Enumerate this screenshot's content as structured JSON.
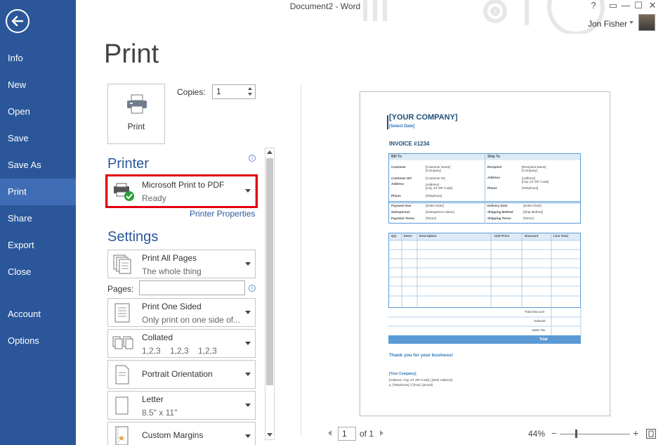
{
  "window": {
    "title": "Document2 - Word",
    "user": "Jon Fisher",
    "controls": [
      "?",
      "▭",
      "—",
      "☐",
      "✕"
    ]
  },
  "sidebar": {
    "items": [
      {
        "label": "Info"
      },
      {
        "label": "New"
      },
      {
        "label": "Open"
      },
      {
        "label": "Save"
      },
      {
        "label": "Save As"
      },
      {
        "label": "Print",
        "active": true
      },
      {
        "label": "Share"
      },
      {
        "label": "Export"
      },
      {
        "label": "Close"
      },
      {
        "label": "Account"
      },
      {
        "label": "Options"
      }
    ]
  },
  "print": {
    "heading": "Print",
    "button_label": "Print",
    "copies_label": "Copies:",
    "copies_value": "1"
  },
  "printer": {
    "heading": "Printer",
    "name": "Microsoft Print to PDF",
    "status": "Ready",
    "properties_link": "Printer Properties"
  },
  "settings": {
    "heading": "Settings",
    "pages_label": "Pages:",
    "pages_value": "",
    "options": [
      {
        "main": "Print All Pages",
        "sub": "The whole thing",
        "icon": "pages-icon"
      },
      {
        "main": "Print One Sided",
        "sub": "Only print on one side of...",
        "icon": "one-sided-icon"
      },
      {
        "main": "Collated",
        "sub": "1,2,3    1,2,3    1,2,3",
        "icon": "collated-icon"
      },
      {
        "main": "Portrait Orientation",
        "sub": "",
        "icon": "portrait-icon"
      },
      {
        "main": "Letter",
        "sub": "8.5\" x 11\"",
        "icon": "paper-size-icon"
      },
      {
        "main": "Custom Margins",
        "sub": "",
        "icon": "margins-icon"
      }
    ]
  },
  "preview": {
    "company": "[YOUR COMPANY]",
    "date": "[Select Date]",
    "invoice": "INVOICE #1234",
    "bill_to": "Bill To",
    "ship_to": "Ship To",
    "bill_rows": [
      {
        "label": "Customer",
        "value": "[Customer Name]\n[Company]"
      },
      {
        "label": "Customer ID#",
        "value": "[Customer ID]"
      },
      {
        "label": "Address",
        "value": "[Address]\n[City, ST ZIP Code]"
      },
      {
        "label": "Phone",
        "value": "[Telephone]"
      }
    ],
    "ship_rows": [
      {
        "label": "Recipient",
        "value": "[Recipient Name]\n[Company]"
      },
      {
        "label": "Address",
        "value": "[Address]\n[City, ST ZIP Code]"
      },
      {
        "label": "Phone",
        "value": "[Telephone]"
      }
    ],
    "pay_rows": [
      {
        "label": "Payment Due",
        "value": "[Select Date]"
      },
      {
        "label": "Salesperson",
        "value": "[Salesperson Name]"
      },
      {
        "label": "Payment Terms",
        "value": "[Terms]"
      }
    ],
    "ship_detail_rows": [
      {
        "label": "Delivery Date",
        "value": "[Select Date]"
      },
      {
        "label": "Shipping Method",
        "value": "[Ship Method]"
      },
      {
        "label": "Shipping Terms",
        "value": "[Terms]"
      }
    ],
    "item_headers": [
      "Qty",
      "Item#",
      "Description",
      "Unit Price",
      "Discount",
      "Line Total"
    ],
    "totals": [
      "Total Discount",
      "Subtotal",
      "Sales Tax",
      "Total"
    ],
    "thanks": "Thank you for your business!",
    "footer_company": "[Your Company]",
    "footer_line1": "[Address, City, ST  ZIP Code]  |  [Web Address]",
    "footer_line2": "p. [Telephone]  |  f.[Fax]  |  [Email]"
  },
  "bottom_bar": {
    "page_value": "1",
    "page_of": "of 1",
    "zoom": "44%"
  },
  "colors": {
    "sidebar": "#2b579a",
    "sidebar_active": "#3e6db5",
    "accent": "#2b579a",
    "highlight": "#e3000f",
    "invoice_blue": "#2e75b6"
  }
}
